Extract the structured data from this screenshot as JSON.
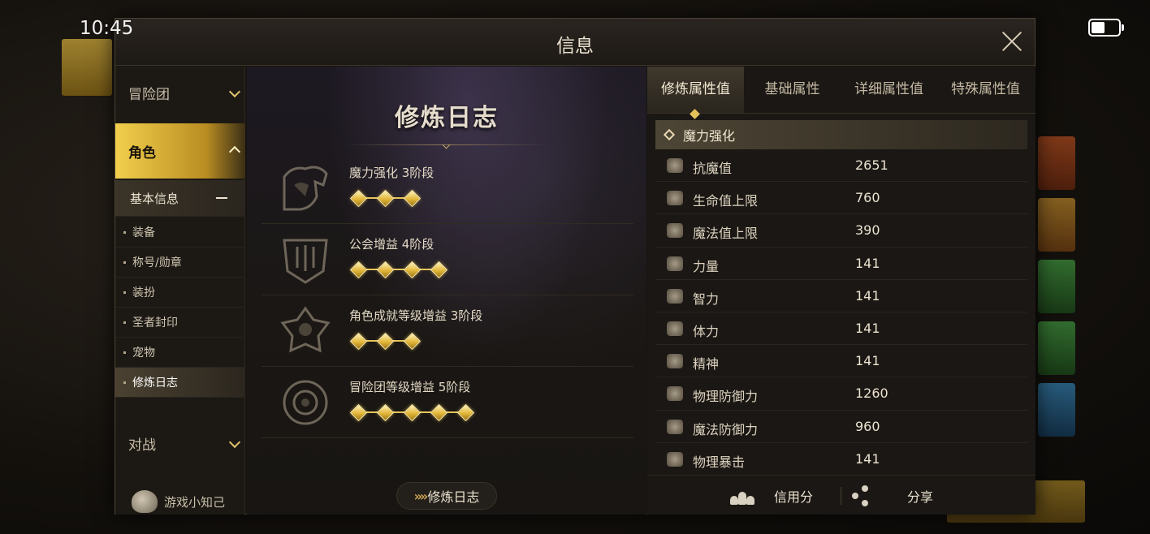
{
  "status": {
    "time": "10:45"
  },
  "modal": {
    "title": "信息"
  },
  "nav": {
    "groups": [
      {
        "label": "冒险团"
      },
      {
        "label": "角色"
      },
      {
        "label": "对战"
      }
    ],
    "sub_head": "基本信息",
    "sub_items": [
      {
        "label": "装备"
      },
      {
        "label": "称号/勋章"
      },
      {
        "label": "装扮"
      },
      {
        "label": "圣者封印"
      },
      {
        "label": "宠物"
      },
      {
        "label": "修炼日志"
      }
    ],
    "footer": "游戏小知己"
  },
  "log": {
    "title": "修炼日志",
    "entries": [
      {
        "label": "魔力强化 3阶段",
        "stage": 3
      },
      {
        "label": "公会增益 4阶段",
        "stage": 4
      },
      {
        "label": "角色成就等级增益 3阶段",
        "stage": 3
      },
      {
        "label": "冒险团等级增益 5阶段",
        "stage": 5
      }
    ],
    "button": "修炼日志"
  },
  "right": {
    "tabs": [
      {
        "label": "修炼属性值"
      },
      {
        "label": "基础属性"
      },
      {
        "label": "详细属性值"
      },
      {
        "label": "特殊属性值"
      }
    ],
    "section": "魔力强化",
    "stats": [
      {
        "name": "抗魔值",
        "value": "2651",
        "icon": "anti-magic-icon"
      },
      {
        "name": "生命值上限",
        "value": "760",
        "icon": "heart-icon"
      },
      {
        "name": "魔法值上限",
        "value": "390",
        "icon": "heart-outline-icon"
      },
      {
        "name": "力量",
        "value": "141",
        "icon": "strength-icon"
      },
      {
        "name": "智力",
        "value": "141",
        "icon": "intelligence-icon"
      },
      {
        "name": "体力",
        "value": "141",
        "icon": "vitality-icon"
      },
      {
        "name": "精神",
        "value": "141",
        "icon": "spirit-icon"
      },
      {
        "name": "物理防御力",
        "value": "1260",
        "icon": "shield-icon"
      },
      {
        "name": "魔法防御力",
        "value": "960",
        "icon": "magic-defense-icon"
      },
      {
        "name": "物理暴击",
        "value": "141",
        "icon": "critical-icon"
      }
    ],
    "footer": {
      "credit": "信用分",
      "share": "分享"
    }
  },
  "colors": {
    "accent": "#e2b73a",
    "panel": "#1a1714"
  }
}
